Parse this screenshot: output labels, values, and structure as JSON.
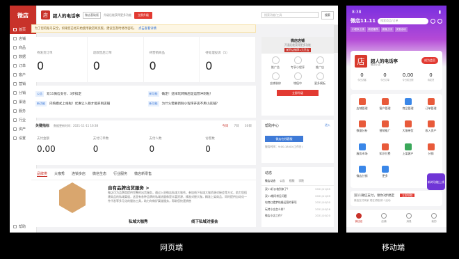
{
  "desktop": {
    "logo": "微店",
    "nav": [
      "首页",
      "店铺",
      "商品",
      "数据",
      "订单",
      "客户",
      "营销",
      "分销",
      "渠道",
      "服务",
      "行业",
      "资产",
      "设置"
    ],
    "bottom_nav": "帮助",
    "topbar": {
      "shop_icon": "店",
      "shop_name": "超人的电话亭",
      "tag": "微店基础版",
      "hint": "升级后能获得更多功能",
      "upgrade": "立即升级",
      "search_placeholder": "搜索功能/工具",
      "search_btn": "搜索"
    },
    "notice": {
      "text": "为了您的账号安全，如果您已经开始使用微店网页版，建议您及时修改密码，",
      "link": "点击查看详情"
    },
    "stats": [
      {
        "label": "待发货订单",
        "value": "0"
      },
      {
        "label": "退款售后订单",
        "value": "0"
      },
      {
        "label": "待营销商品",
        "value": "0"
      },
      {
        "label": "待处理投诉（5）",
        "value": "0"
      }
    ],
    "news": [
      {
        "tag": "公告",
        "text": "双11微信支付、3步搞定"
      },
      {
        "tag": "新功能",
        "text": "内购模式上线啦！优惠让人群才能买到店铺"
      },
      {
        "tag": "新功能",
        "text": "确定！这样玩转微店促运营冲刺啦！"
      },
      {
        "tag": "新功能",
        "text": "为什么需要新鲜小程序开店不用小店铺？"
      }
    ],
    "key_data": {
      "title": "关键指标",
      "meta": "数据更新时间：2021-11-11 16:38",
      "ranges": [
        "今日",
        "7日",
        "30日"
      ],
      "items": [
        {
          "label": "支付金额",
          "value": "0.00"
        },
        {
          "label": "支付订单数",
          "value": "0"
        },
        {
          "label": "支付人数",
          "value": "0"
        },
        {
          "label": "访客数",
          "value": "0"
        }
      ]
    },
    "product_tabs": [
      "品牌类",
      "大咖秀",
      "连锁多店",
      "微信生态",
      "行业服务",
      "微店新零售"
    ],
    "product": {
      "title": "自有品牌出货服务 >",
      "desc": "微店可为品牌商提供完整的出货服务，通过入驻微店私域大咖秀，参加线下私域大咖资源对接会等方式，助力您搭建商品的私域渠道，这里有各种品牌的私域流量像是丰富资源，精准对接大咖，精准上架商品，同时提供自动化一件代发等多元化的服务工具，助力你做好渠道服务，帮助您快速销售",
      "b1": "私域大咖秀",
      "b2": "线下私域对接会"
    },
    "shop_card": {
      "name": "微店店铺",
      "sub": "开通后能获得更多功能",
      "badge": "新开店铺享1元开店",
      "items": [
        "推广告",
        "专享小程序",
        "推广店",
        "店铺装修",
        "增值中",
        "更多模板"
      ],
      "go": "立即升级"
    },
    "help": {
      "title": "帮助中心",
      "more": "进入",
      "btn": "微店在线客服",
      "sub": "服务时间：9:00-18:00(工作日)"
    },
    "feed": {
      "title": "动态",
      "tabs": [
        "微店动态",
        "公告",
        "视频",
        "学院"
      ],
      "rows": [
        {
          "t": "双11好价格到来了？",
          "d": "2021/11/09"
        },
        {
          "t": "双11期间常见问题",
          "d": "2021/11/09"
        },
        {
          "t": "电商红楼梦结婚运营的事项",
          "d": "2021/10/30"
        },
        {
          "t": "玩转小店怎么样？",
          "d": "2021/10/26"
        },
        {
          "t": "微店小店工作？",
          "d": "2021/10/20"
        }
      ]
    },
    "label": "网页端"
  },
  "mobile": {
    "time": "8:38",
    "logo": "微店11.11",
    "search_placeholder": "搜索商品/订单",
    "pills": [
      "小程序上线",
      "新品推荐",
      "直播上线",
      "优惠活动",
      "商品推荐上线",
      "微信社群"
    ],
    "shop": {
      "icon": "店",
      "name": "超人的电话亭",
      "tag": "微店小店",
      "btn": "成为会员",
      "stats": [
        {
          "v": "0",
          "l": "今日访客"
        },
        {
          "v": "0",
          "l": "今日订单"
        },
        {
          "v": "0.00",
          "l": "今日成交额"
        },
        {
          "v": "0",
          "l": "待发货"
        }
      ]
    },
    "grid": [
      {
        "l": "店铺管理",
        "c": "#e85a3a"
      },
      {
        "l": "客户管理",
        "c": "#e85a3a"
      },
      {
        "l": "商品管理",
        "c": "#3a87e8"
      },
      {
        "l": "订单管理",
        "c": "#e85a3a"
      },
      {
        "l": "数据分析",
        "c": "#e85a3a"
      },
      {
        "l": "营销推广",
        "c": "#e85a3a"
      },
      {
        "l": "大咖带货",
        "c": "#e85a3a"
      },
      {
        "l": "收入资产",
        "c": "#e85a3a"
      },
      {
        "l": "服务市场",
        "c": "#3a87e8"
      },
      {
        "l": "知识付费",
        "c": "#e85a3a"
      },
      {
        "l": "上架客户",
        "c": "#3aa85a"
      },
      {
        "l": "分销",
        "c": "#e85a3a"
      },
      {
        "l": "微店分销",
        "c": "#3a87e8"
      },
      {
        "l": "更多",
        "c": "#3a87e8"
      }
    ],
    "banner": {
      "t": "双11微信支付，领你3步搞定",
      "btn": "立即领取",
      "sub": "微信支付商家 现在领取双11活动"
    },
    "promo": "新的功能上线",
    "tabs": [
      "微店店",
      "店铺",
      "消息",
      "我的"
    ],
    "label": "移动端"
  }
}
